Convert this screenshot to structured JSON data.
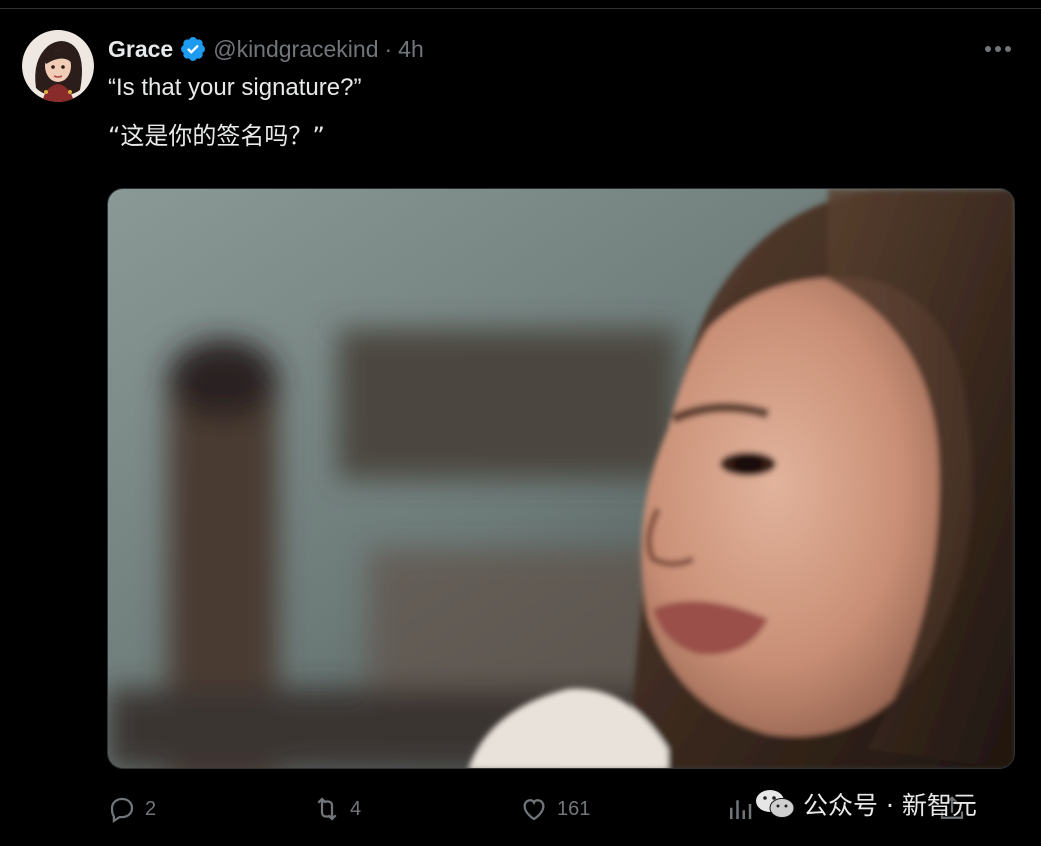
{
  "tweet": {
    "author": {
      "display_name": "Grace",
      "handle": "@kindgracekind",
      "separator": "·",
      "timestamp": "4h",
      "verified": true
    },
    "text_lines": [
      "“Is that your signature?”",
      "“这是你的签名吗？”"
    ],
    "media": {
      "type": "image"
    },
    "actions": {
      "reply_count": "2",
      "retweet_count": "4",
      "like_count": "161",
      "views_count": ""
    }
  },
  "icons": {
    "verified": "verified-badge-icon",
    "more": "more-horizontal-icon",
    "reply": "reply-icon",
    "retweet": "retweet-icon",
    "like": "heart-icon",
    "views": "views-bar-chart-icon",
    "share": "share-icon",
    "watermark": "wechat-icon"
  },
  "watermark": {
    "text": "公众号 · 新智元"
  },
  "colors": {
    "background": "#000000",
    "text_primary": "#e7e9ea",
    "text_secondary": "#71767b",
    "verified_blue": "#1d9bf0",
    "divider": "#2f3336"
  }
}
